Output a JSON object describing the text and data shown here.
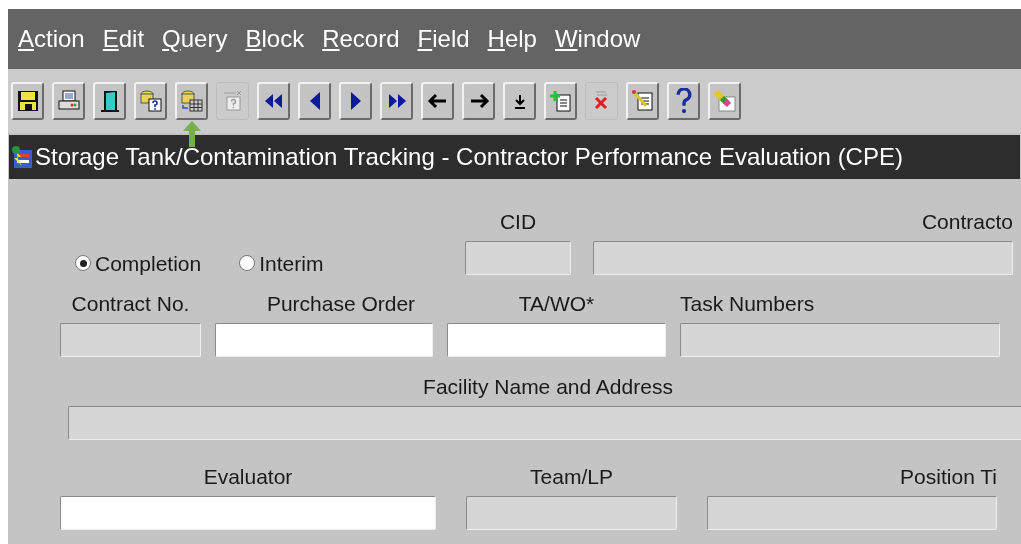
{
  "menu": [
    {
      "label": "Action"
    },
    {
      "label": "Edit"
    },
    {
      "label": "Query"
    },
    {
      "label": "Block"
    },
    {
      "label": "Record"
    },
    {
      "label": "Field"
    },
    {
      "label": "Help"
    },
    {
      "label": "Window"
    }
  ],
  "toolbar": [
    {
      "kind": "save",
      "disabled": false
    },
    {
      "kind": "print",
      "disabled": false
    },
    {
      "kind": "exit",
      "disabled": false
    },
    {
      "kind": "enter-query",
      "disabled": false
    },
    {
      "kind": "execute-query",
      "disabled": false,
      "pointer": true
    },
    {
      "kind": "cancel-query",
      "disabled": true
    },
    {
      "kind": "first",
      "disabled": false
    },
    {
      "kind": "previous",
      "disabled": false
    },
    {
      "kind": "next",
      "disabled": false
    },
    {
      "kind": "last",
      "disabled": false
    },
    {
      "kind": "left",
      "disabled": false
    },
    {
      "kind": "right",
      "disabled": false
    },
    {
      "kind": "down",
      "disabled": false
    },
    {
      "kind": "insert",
      "disabled": false
    },
    {
      "kind": "delete",
      "disabled": true
    },
    {
      "kind": "edit",
      "disabled": false
    },
    {
      "kind": "help",
      "disabled": false
    },
    {
      "kind": "clear",
      "disabled": false
    }
  ],
  "window": {
    "title": "Storage Tank/Contamination Tracking - Contractor Performance Evaluation (CPE)"
  },
  "evaluation_type": [
    {
      "label": "Completion",
      "selected": true
    },
    {
      "label": "Interim",
      "selected": false
    }
  ],
  "fields": [
    {
      "label": "CID",
      "disabled": true
    },
    {
      "label": "Contracto",
      "disabled": true
    },
    {
      "label": "Contract No.",
      "disabled": true
    },
    {
      "label": "Purchase Order",
      "disabled": false
    },
    {
      "label": "TA/WO*",
      "disabled": false
    },
    {
      "label": "Task Numbers",
      "disabled": true
    },
    {
      "label": "Facility Name and Address",
      "disabled": true
    },
    {
      "label": "Evaluator",
      "disabled": false
    },
    {
      "label": "Team/LP",
      "disabled": true
    },
    {
      "label": "Position Ti",
      "disabled": true
    }
  ]
}
